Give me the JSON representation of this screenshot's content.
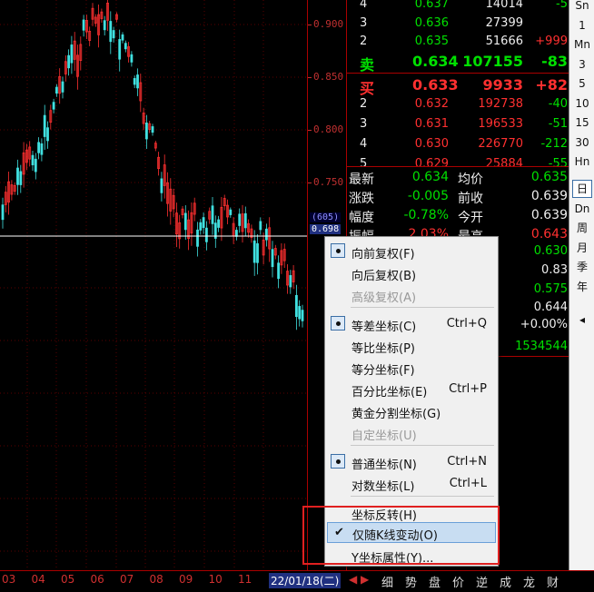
{
  "axis": {
    "labels": [
      "0.900",
      "0.850",
      "0.800",
      "0.750",
      "0.698"
    ],
    "tag_count": "(605)",
    "tag_price": "0.698"
  },
  "order_book": {
    "sell": [
      {
        "level": "4",
        "price": "0.637",
        "volume": "14014",
        "change": "-5"
      },
      {
        "level": "3",
        "price": "0.636",
        "volume": "27399",
        "change": ""
      },
      {
        "level": "2",
        "price": "0.635",
        "volume": "51666",
        "change": "+999"
      },
      {
        "level": "卖",
        "price": "0.634",
        "volume": "107155",
        "change": "-83"
      }
    ],
    "buy": [
      {
        "level": "买",
        "price": "0.633",
        "volume": "9933",
        "change": "+82"
      },
      {
        "level": "2",
        "price": "0.632",
        "volume": "192738",
        "change": "-40"
      },
      {
        "level": "3",
        "price": "0.631",
        "volume": "196533",
        "change": "-51"
      },
      {
        "level": "4",
        "price": "0.630",
        "volume": "226770",
        "change": "-212"
      },
      {
        "level": "5",
        "price": "0.629",
        "volume": "25884",
        "change": "-55"
      }
    ]
  },
  "stats": [
    {
      "l1": "最新",
      "v1": "0.634",
      "l2": "均价",
      "v2": "0.635"
    },
    {
      "l1": "涨跌",
      "v1": "-0.005",
      "l2": "前收",
      "v2": "0.639"
    },
    {
      "l1": "幅度",
      "v1": "-0.78%",
      "l2": "今开",
      "v2": "0.639"
    },
    {
      "l1": "振幅",
      "v1": "2.03%",
      "l2": "最高",
      "v2": "0.643"
    }
  ],
  "stats_right_values": [
    "0.630",
    "0.83",
    "0.575",
    "0.644",
    "+0.00%",
    "1534544"
  ],
  "period_buttons": [
    "Sn",
    "1",
    "Mn",
    "3",
    "5",
    "10",
    "15",
    "30",
    "Hn",
    "日",
    "Dn",
    "周",
    "月",
    "季",
    "年"
  ],
  "bottom_dates": [
    "03",
    "04",
    "05",
    "06",
    "07",
    "08",
    "09",
    "10",
    "11"
  ],
  "bottom_current_date": "22/01/18(二)",
  "bottom_tabs": [
    "细",
    "势",
    "盘",
    "价",
    "逆",
    "成",
    "龙",
    "财"
  ],
  "context_menu": {
    "items": [
      {
        "label": "向前复权(F)",
        "shortcut": "",
        "state": "bullet",
        "disabled": false
      },
      {
        "label": "向后复权(B)",
        "shortcut": "",
        "state": "",
        "disabled": false
      },
      {
        "label": "高级复权(A)",
        "shortcut": "",
        "state": "",
        "disabled": true
      },
      {
        "label": "等差坐标(C)",
        "shortcut": "Ctrl+Q",
        "state": "bullet",
        "disabled": false
      },
      {
        "label": "等比坐标(P)",
        "shortcut": "",
        "state": "",
        "disabled": false
      },
      {
        "label": "等分坐标(F)",
        "shortcut": "",
        "state": "",
        "disabled": false
      },
      {
        "label": "百分比坐标(E)",
        "shortcut": "Ctrl+P",
        "state": "",
        "disabled": false
      },
      {
        "label": "黄金分割坐标(G)",
        "shortcut": "",
        "state": "",
        "disabled": false
      },
      {
        "label": "自定坐标(U)",
        "shortcut": "",
        "state": "",
        "disabled": true
      },
      {
        "label": "普通坐标(N)",
        "shortcut": "Ctrl+N",
        "state": "bullet",
        "disabled": false
      },
      {
        "label": "对数坐标(L)",
        "shortcut": "Ctrl+L",
        "state": "",
        "disabled": false
      },
      {
        "label": "坐标反转(H)",
        "shortcut": "",
        "state": "",
        "disabled": false
      },
      {
        "label": "仅随K线变动(O)",
        "shortcut": "",
        "state": "check",
        "disabled": false
      },
      {
        "label": "Y坐标属性(Y)...",
        "shortcut": "",
        "state": "",
        "disabled": false
      }
    ]
  },
  "colors": {
    "up": "#ff3030",
    "down": "#40e0e0",
    "axis": "#c03030",
    "highlight": "#c8ddf2",
    "box": "#e02020"
  }
}
